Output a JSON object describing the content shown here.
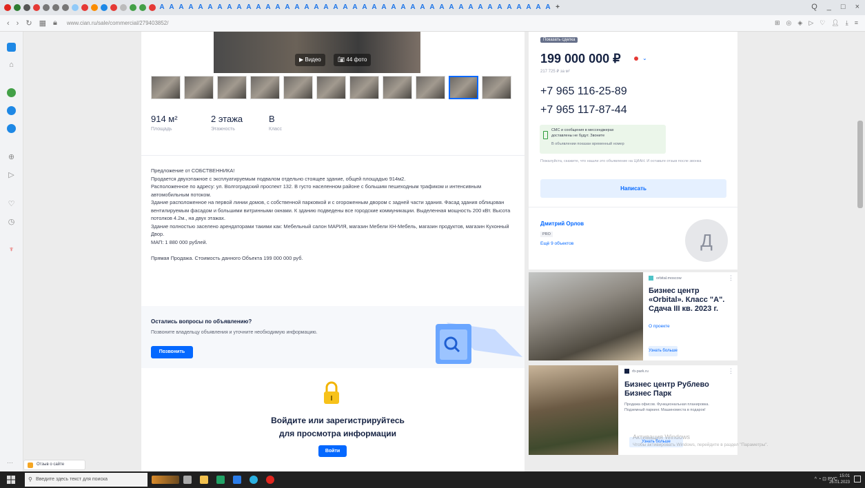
{
  "browser": {
    "url": "www.cian.ru/sale/commercial/279403852/",
    "window_controls": [
      "Q",
      "_",
      "□",
      "×"
    ]
  },
  "listing": {
    "video_label": "Видео",
    "photos_label": "44 фото",
    "area_value": "914 м²",
    "area_label": "Площадь",
    "floors_value": "2 этажа",
    "floors_label": "Этажность",
    "class_value": "B",
    "class_label": "Класс",
    "description": "Предложение от СОБСТВЕННИКА!\nПродается двухэтажное с эксплуатируемым подвалом отдельно стоящее здание, общей площадью 914м2.\nРасположенное по адресу: ул. Волгоградский проспект 132. В густо населенном районе с большим пешеходным  трафиком и интенсивным автомобильным потоком.\nЗдание расположенное на первой линии домов, с собственной парковкой и с огороженным двором с задней части здания.  Фасад здания облицован вентилируемым фасадом и большими витринными окнами. К зданию подведены все городские коммуникации. Выделенная мощность  200 кВт. Высота потолков 4.2м., на двух этажах.\nЗдание полностью заселено арендаторами такими как: Мебельный салон МАРИЯ, магазин Мебели КН-Мебель, магазин продуктов, магазин Кухонный Двор.\nМАП: 1 880 000 рублей.\n\nПрямая Продажа.  Стоимость данного Объекта 199 000 000 руб."
  },
  "questions": {
    "title": "Остались вопросы по объявлению?",
    "subtitle": "Позвоните владельцу объявления и уточните необходимую информацию.",
    "call_button": "Позвонить"
  },
  "login": {
    "title_line1": "Войдите или зарегистрируйтесь",
    "title_line2": "для просмотра информации",
    "button": "Войти"
  },
  "sidebar_offer": {
    "owner_badge": "Показать сделка",
    "price": "199 000 000 ₽",
    "price_per_m2": "217 725 ₽ за м²",
    "phone1": "+7 965 116-25-89",
    "phone2": "+7 965 117-87-44",
    "sms_line1": "СМС и сообщения в мессенджерах",
    "sms_line2": "доставлены не будут. Звоните",
    "sms_line3": "В объявлении показан временный номер",
    "warning": "Пожалуйста, скажите, что нашли это объявление на ЦИАН. И оставьте отзыв после звонка",
    "write_button": "Написать"
  },
  "agent": {
    "name": "Дмитрий Орлов",
    "badge": "PRO",
    "more": "Ещё 9 объектов",
    "avatar_letter": "Д"
  },
  "ads": [
    {
      "source": "orbital.moscow",
      "title": "Бизнес центр «Orbital». Класс \"А\". Сдача III кв. 2023 г.",
      "link": "О проекте",
      "button": "Узнать больше"
    },
    {
      "source": "rb-park.ru",
      "title": "Бизнес центр Рублево Бизнес Парк",
      "desc": "Продажа офисов. Функциональная планировка. Подземный паркинг. Машиноместа в подарок!",
      "button": "Узнать больше"
    }
  ],
  "windows_activation": {
    "line1": "Активация Windows",
    "line2": "Чтобы активировать Windows, перейдите в раздел \"Параметры\"."
  },
  "bottom": {
    "feedback": "Отзыв о сайте",
    "search_placeholder": "Введите здесь текст для поиска",
    "tray": "РУС",
    "time": "15:01",
    "date": "26.01.2023"
  }
}
